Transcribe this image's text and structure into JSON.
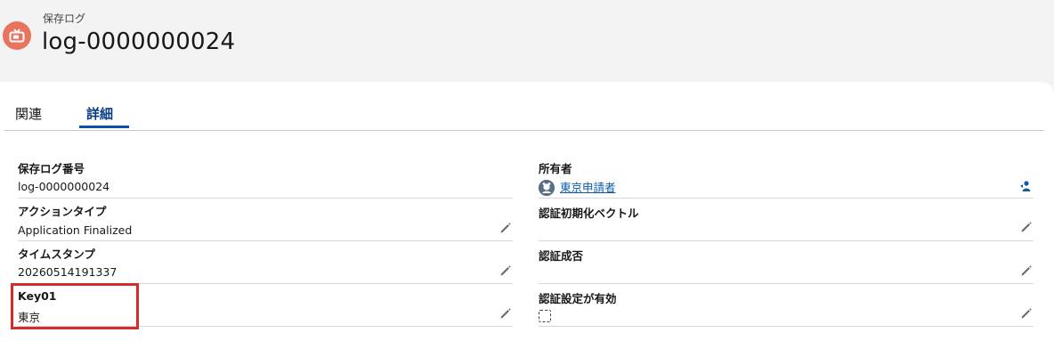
{
  "header": {
    "object_type": "保存ログ",
    "record_name": "log-0000000024"
  },
  "tabs": [
    {
      "label": "関連",
      "active": false
    },
    {
      "label": "詳細",
      "active": true
    }
  ],
  "fields_left": [
    {
      "label": "保存ログ番号",
      "value": "log-0000000024",
      "editable": false
    },
    {
      "label": "アクションタイプ",
      "value": "Application Finalized",
      "editable": true
    },
    {
      "label": "タイムスタンプ",
      "value": "20260514191337",
      "editable": true
    },
    {
      "label": "Key01",
      "value": "東京",
      "editable": true
    }
  ],
  "fields_right": [
    {
      "label": "所有者",
      "value": "東京申請者",
      "type": "user-link"
    },
    {
      "label": "認証初期化ベクトル",
      "value": "",
      "editable": true
    },
    {
      "label": "認証成否",
      "value": "",
      "editable": true
    },
    {
      "label": "認証設定が有効",
      "value": "",
      "type": "checkbox",
      "checked": false,
      "editable": true
    }
  ],
  "colors": {
    "header_icon_bg": "#e8735e",
    "active_tab": "#0b3f86",
    "link": "#0b5cab",
    "highlight": "#d42c2c"
  }
}
